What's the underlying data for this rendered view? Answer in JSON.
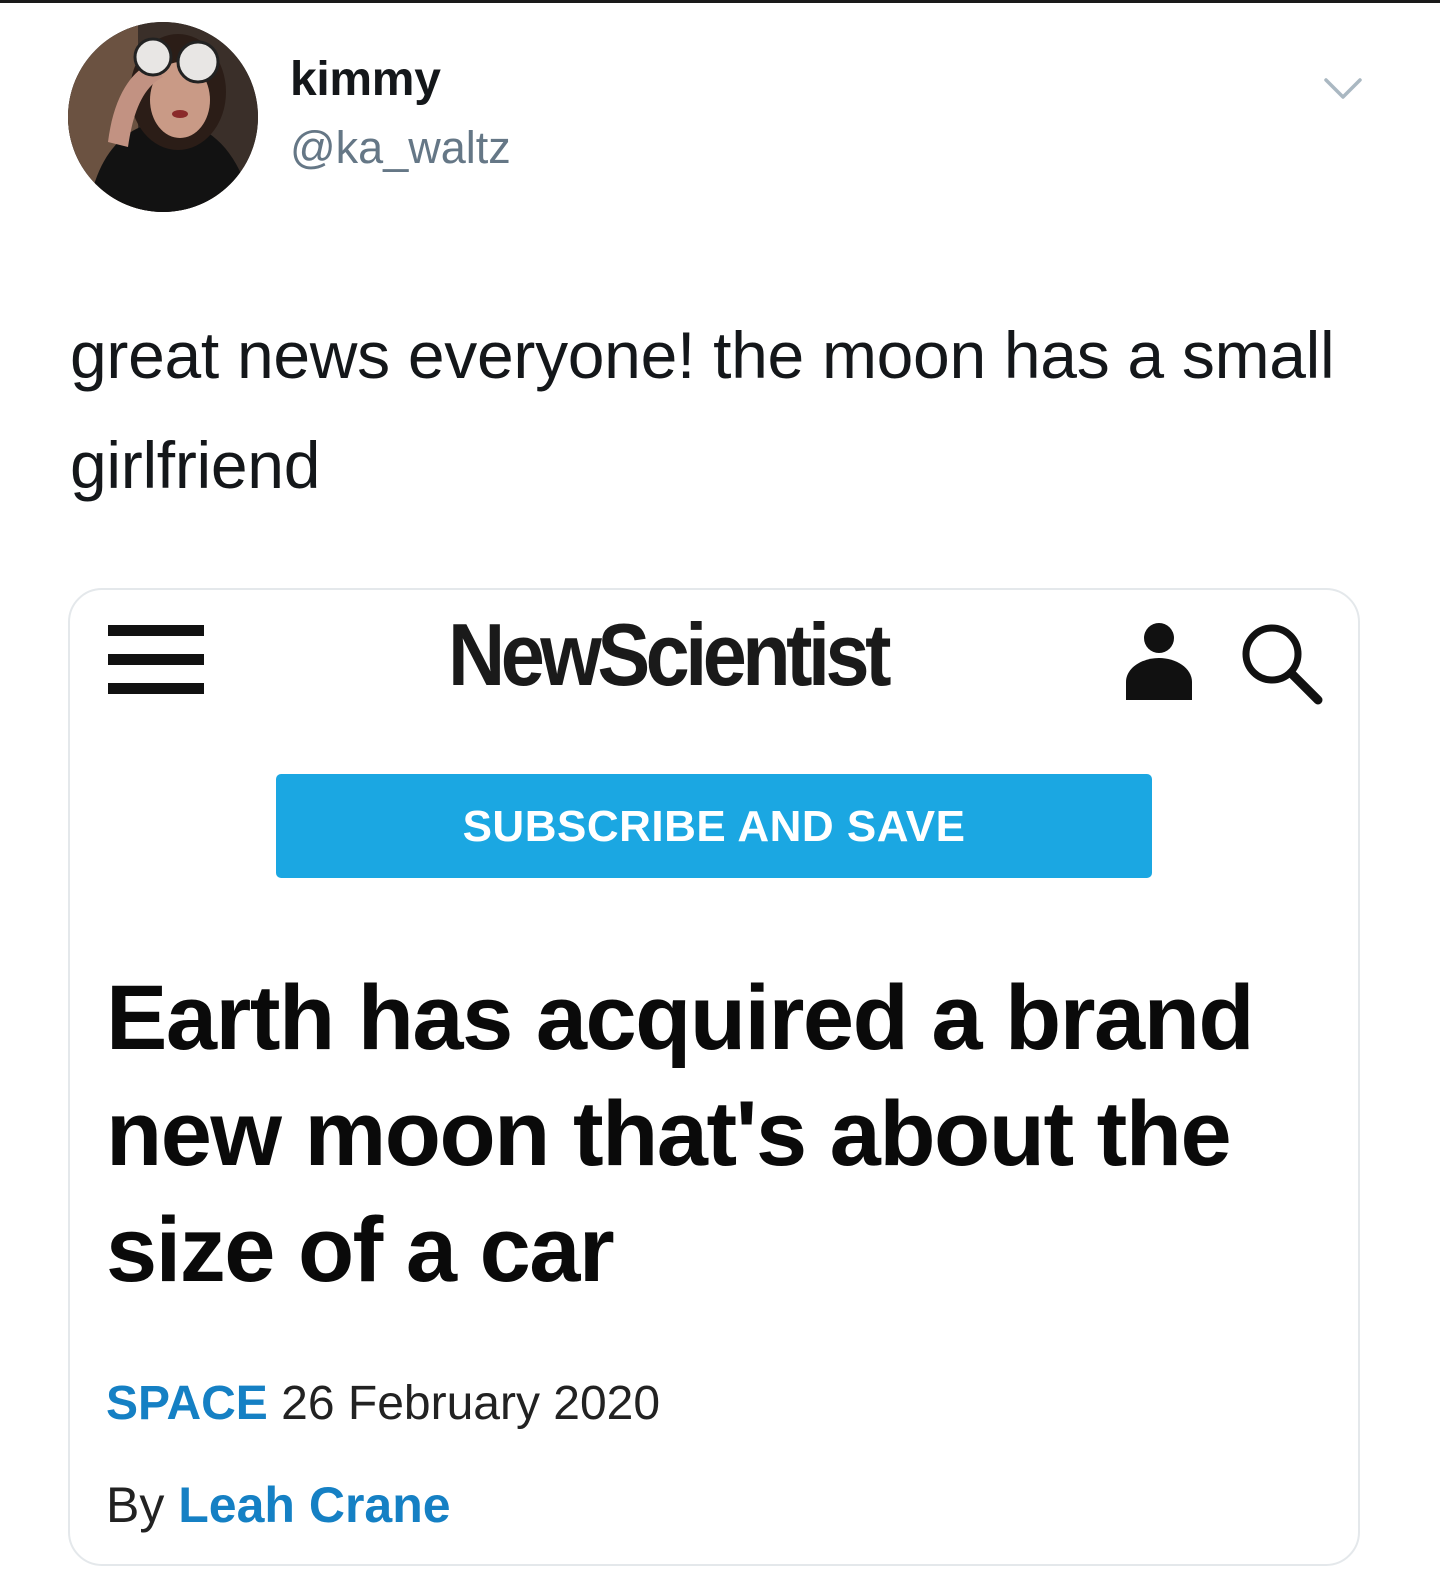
{
  "tweet": {
    "display_name": "kimmy",
    "handle": "@ka_waltz",
    "text": "great news everyone! the moon has a small girlfriend"
  },
  "card": {
    "site_logo": "NewScientist",
    "subscribe_label": "SUBSCRIBE AND SAVE",
    "headline": "Earth has acquired a brand new moon that's about the size of a car",
    "section": "SPACE",
    "date": "26 February 2020",
    "byline_prefix": "By",
    "author": "Leah Crane"
  },
  "icons": {
    "menu": "hamburger-menu-icon",
    "account": "user-icon",
    "search": "search-icon",
    "more": "chevron-down-icon"
  },
  "colors": {
    "subscribe_bg": "#1ba7e2",
    "link_blue": "#1580c4",
    "handle_gray": "#657786"
  }
}
